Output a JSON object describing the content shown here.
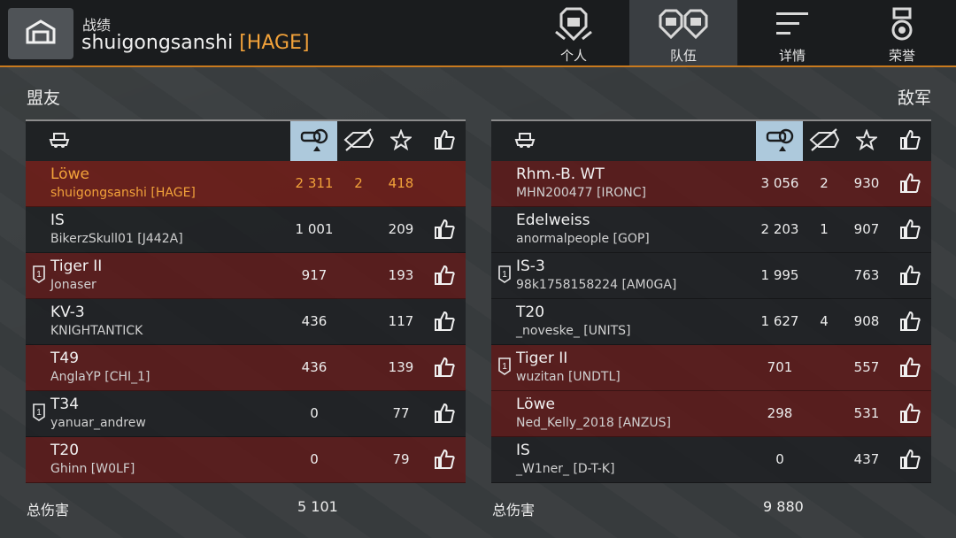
{
  "header": {
    "subtitle": "战绩",
    "player_name": "shuigongsanshi",
    "player_clan": "[HAGE]",
    "tabs": [
      {
        "label": "个人",
        "icon": "tank-crest-icon",
        "active": false
      },
      {
        "label": "队伍",
        "icon": "team-crest-icon",
        "active": true
      },
      {
        "label": "详情",
        "icon": "details-lines-icon",
        "active": false
      },
      {
        "label": "荣誉",
        "icon": "medal-icon",
        "active": false
      }
    ]
  },
  "allies": {
    "title": "盟友",
    "total_label": "总伤害",
    "total_damage": "5 101",
    "rows": [
      {
        "vehicle": "Löwe",
        "player": "shuigongsanshi [HAGE]",
        "damage": "2 311",
        "kills": "2",
        "score": "418",
        "style": "me",
        "rank_badge": false,
        "like": false
      },
      {
        "vehicle": "IS",
        "player": "BikerzSkull01 [J442A]",
        "damage": "1 001",
        "kills": "",
        "score": "209",
        "style": "dark",
        "rank_badge": false,
        "like": true
      },
      {
        "vehicle": "Tiger II",
        "player": "Jonaser",
        "damage": "917",
        "kills": "",
        "score": "193",
        "style": "red",
        "rank_badge": true,
        "like": true
      },
      {
        "vehicle": "KV-3",
        "player": "KNIGHTANTICK",
        "damage": "436",
        "kills": "",
        "score": "117",
        "style": "dark",
        "rank_badge": false,
        "like": true
      },
      {
        "vehicle": "T49",
        "player": "AnglaYP [CHI_1]",
        "damage": "436",
        "kills": "",
        "score": "139",
        "style": "red",
        "rank_badge": false,
        "like": true
      },
      {
        "vehicle": "T34",
        "player": "yanuar_andrew",
        "damage": "0",
        "kills": "",
        "score": "77",
        "style": "dark",
        "rank_badge": true,
        "like": true
      },
      {
        "vehicle": "T20",
        "player": "Ghinn [W0LF]",
        "damage": "0",
        "kills": "",
        "score": "79",
        "style": "red",
        "rank_badge": false,
        "like": true
      }
    ]
  },
  "enemies": {
    "title": "敌军",
    "total_label": "总伤害",
    "total_damage": "9 880",
    "rows": [
      {
        "vehicle": "Rhm.-B. WT",
        "player": "MHN200477 [IRONC]",
        "damage": "3 056",
        "kills": "2",
        "score": "930",
        "style": "red",
        "rank_badge": false,
        "like": true
      },
      {
        "vehicle": "Edelweiss",
        "player": "anormalpeople [GOP]",
        "damage": "2 203",
        "kills": "1",
        "score": "907",
        "style": "dark",
        "rank_badge": false,
        "like": true
      },
      {
        "vehicle": "IS-3",
        "player": "98k1758158224 [AM0GA]",
        "damage": "1 995",
        "kills": "",
        "score": "763",
        "style": "dark",
        "rank_badge": true,
        "like": true
      },
      {
        "vehicle": "T20",
        "player": "_noveske_ [UNITS]",
        "damage": "1 627",
        "kills": "4",
        "score": "908",
        "style": "dark",
        "rank_badge": false,
        "like": true
      },
      {
        "vehicle": "Tiger II",
        "player": "wuzitan [UNDTL]",
        "damage": "701",
        "kills": "",
        "score": "557",
        "style": "red",
        "rank_badge": true,
        "like": true
      },
      {
        "vehicle": "Löwe",
        "player": "Ned_Kelly_2018 [ANZUS]",
        "damage": "298",
        "kills": "",
        "score": "531",
        "style": "red",
        "rank_badge": false,
        "like": true
      },
      {
        "vehicle": "IS",
        "player": "_W1ner_ [D-T-K]",
        "damage": "0",
        "kills": "",
        "score": "437",
        "style": "dark",
        "rank_badge": false,
        "like": true
      }
    ]
  },
  "columns": {
    "icons": [
      "tank-icon",
      "damage-icon",
      "kills-icon",
      "star-icon",
      "thumbs-up-icon"
    ],
    "sorted": "damage-icon"
  },
  "colors": {
    "accent_orange": "#f2a23a",
    "header_line": "#c97a1e",
    "sorted_column": "#adc9dc",
    "row_red": "#601616",
    "row_dark": "#1c1e20"
  }
}
